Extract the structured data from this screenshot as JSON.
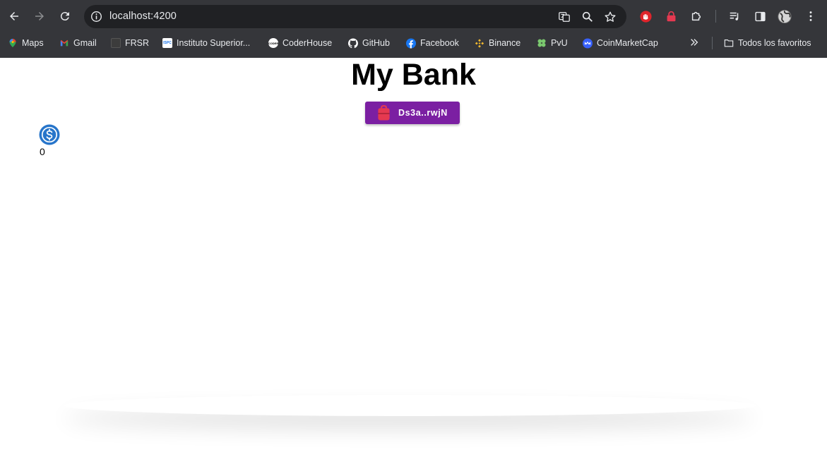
{
  "browser": {
    "url": "localhost:4200",
    "bookmarks": [
      {
        "label": "Maps",
        "icon": "maps-icon"
      },
      {
        "label": "Gmail",
        "icon": "gmail-icon"
      },
      {
        "label": "FRSR",
        "icon": "frsr-icon"
      },
      {
        "label": "Instituto Superior...",
        "icon": "ispc-icon",
        "icon_text": "ISPC"
      },
      {
        "label": "CoderHouse",
        "icon": "coderhouse-icon",
        "icon_text": "CODER"
      },
      {
        "label": "GitHub",
        "icon": "github-icon"
      },
      {
        "label": "Facebook",
        "icon": "facebook-icon"
      },
      {
        "label": "Binance",
        "icon": "binance-icon"
      },
      {
        "label": "PvU",
        "icon": "pvu-icon"
      },
      {
        "label": "CoinMarketCap",
        "icon": "coinmarketcap-icon"
      }
    ],
    "all_bookmarks_label": "Todos los favoritos"
  },
  "page": {
    "title": "My Bank",
    "wallet_button_label": "Ds3a..rwjN",
    "token_balance": "0"
  },
  "colors": {
    "wallet_button": "#7b1fa2",
    "wallet_icon": "#e53950",
    "token_icon": "#2775ca"
  }
}
